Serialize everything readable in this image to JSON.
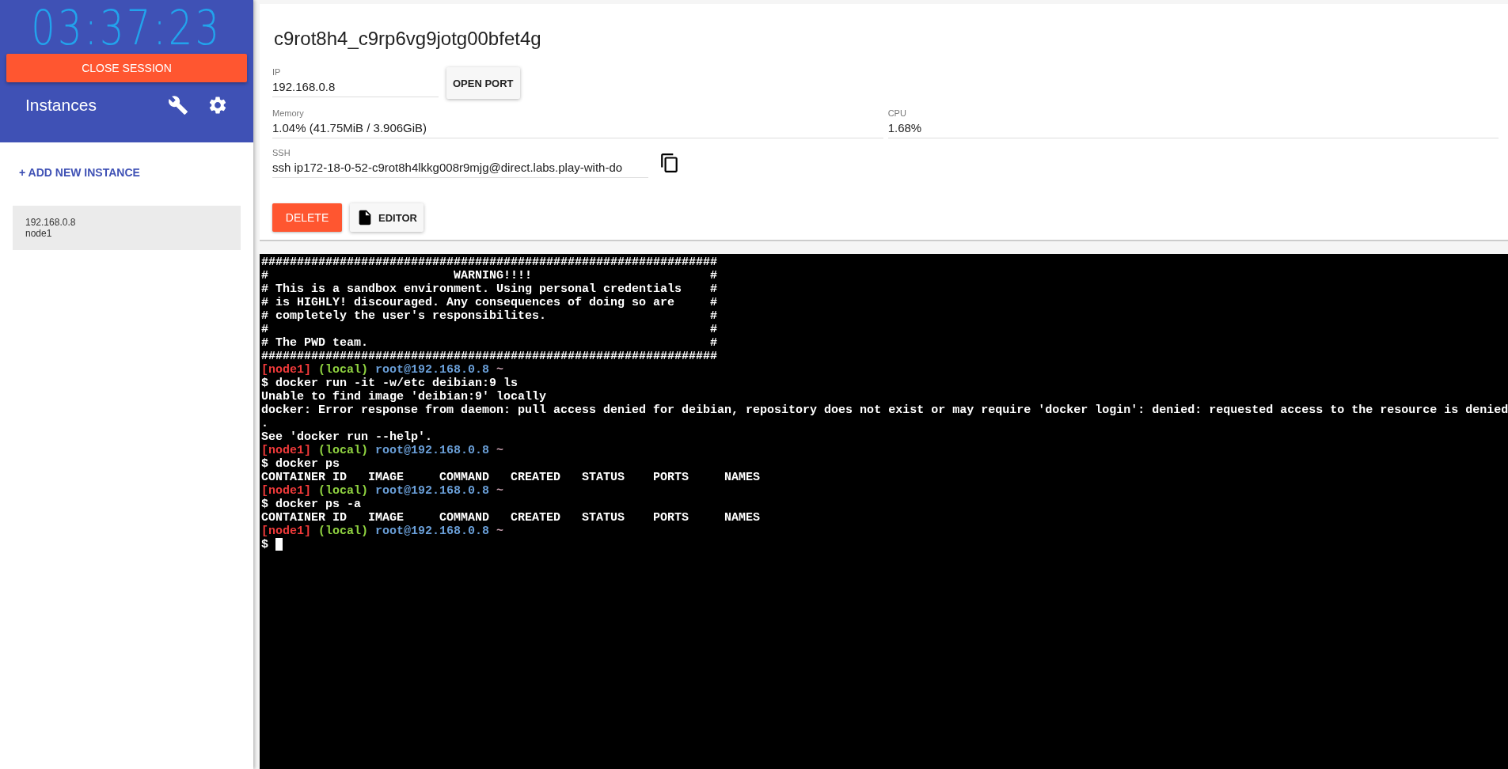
{
  "sidebar": {
    "timer": "03:37:23",
    "close_button": "CLOSE SESSION",
    "heading": "Instances",
    "add_button": "+ ADD NEW INSTANCE",
    "instances": [
      {
        "ip": "192.168.0.8",
        "name": "node1",
        "selected": true
      }
    ]
  },
  "instance": {
    "title": "c9rot8h4_c9rp6vg9jotg00bfet4g",
    "ip": {
      "label": "IP",
      "value": "192.168.0.8"
    },
    "open_port_button": "OPEN PORT",
    "memory": {
      "label": "Memory",
      "value": "1.04% (41.75MiB / 3.906GiB)"
    },
    "cpu": {
      "label": "CPU",
      "value": "1.68%"
    },
    "ssh": {
      "label": "SSH",
      "value": "ssh ip172-18-0-52-c9rot8h4lkkg008r9mjg@direct.labs.play-with-do"
    },
    "delete_button": "DELETE",
    "editor_button": "EDITOR"
  },
  "terminal": {
    "lines": [
      {
        "kind": "text",
        "text": "################################################################"
      },
      {
        "kind": "text",
        "text": "#                          WARNING!!!!                         #"
      },
      {
        "kind": "text",
        "text": "# This is a sandbox environment. Using personal credentials    #"
      },
      {
        "kind": "text",
        "text": "# is HIGHLY! discouraged. Any consequences of doing so are     #"
      },
      {
        "kind": "text",
        "text": "# completely the user's responsibilites.                       #"
      },
      {
        "kind": "text",
        "text": "#                                                              #"
      },
      {
        "kind": "text",
        "text": "# The PWD team.                                                #"
      },
      {
        "kind": "text",
        "text": "################################################################"
      },
      {
        "kind": "prompt",
        "node": "[node1]",
        "env": "(local)",
        "host": "root@192.168.0.8",
        "dir": "~"
      },
      {
        "kind": "text",
        "text": "$ docker run -it -w/etc deibian:9 ls"
      },
      {
        "kind": "text",
        "text": "Unable to find image 'deibian:9' locally"
      },
      {
        "kind": "text",
        "text": "docker: Error response from daemon: pull access denied for deibian, repository does not exist or may require 'docker login': denied: requested access to the resource is denied"
      },
      {
        "kind": "text",
        "text": "."
      },
      {
        "kind": "text",
        "text": "See 'docker run --help'."
      },
      {
        "kind": "prompt",
        "node": "[node1]",
        "env": "(local)",
        "host": "root@192.168.0.8",
        "dir": "~"
      },
      {
        "kind": "text",
        "text": "$ docker ps"
      },
      {
        "kind": "text",
        "text": "CONTAINER ID   IMAGE     COMMAND   CREATED   STATUS    PORTS     NAMES"
      },
      {
        "kind": "prompt",
        "node": "[node1]",
        "env": "(local)",
        "host": "root@192.168.0.8",
        "dir": "~"
      },
      {
        "kind": "text",
        "text": "$ docker ps -a"
      },
      {
        "kind": "text",
        "text": "CONTAINER ID   IMAGE     COMMAND   CREATED   STATUS    PORTS     NAMES"
      },
      {
        "kind": "prompt",
        "node": "[node1]",
        "env": "(local)",
        "host": "root@192.168.0.8",
        "dir": "~"
      },
      {
        "kind": "input",
        "text": "$"
      }
    ]
  }
}
